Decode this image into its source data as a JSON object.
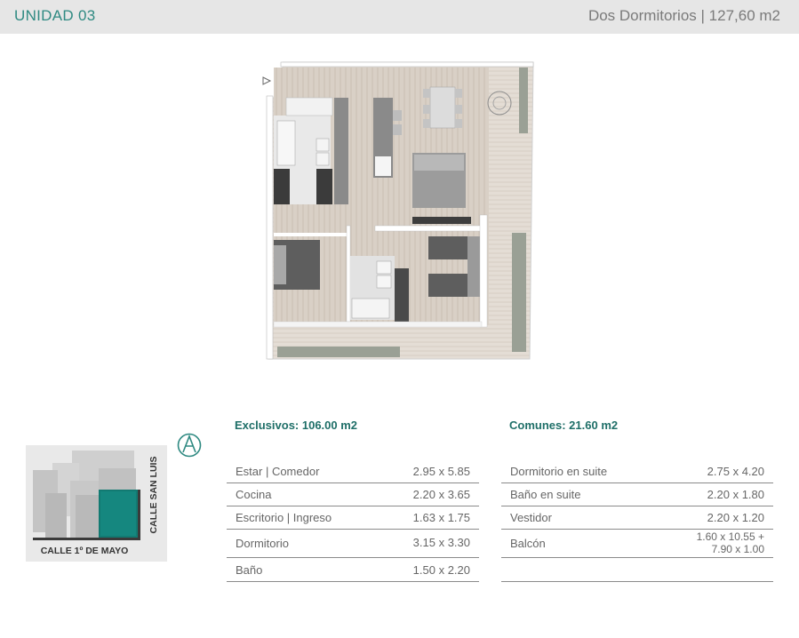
{
  "header": {
    "unit_title": "UNIDAD 03",
    "subtitle": "Dos Dormitorios | 127,60 m2"
  },
  "exclusivos": {
    "title": "Exclusivos: 106.00 m2",
    "rows": [
      {
        "label": "Estar | Comedor",
        "value": "2.95 x 5.85"
      },
      {
        "label": "Cocina",
        "value": "2.20 x 3.65"
      },
      {
        "label": "Escritorio | Ingreso",
        "value": "1.63 x 1.75"
      },
      {
        "label": "Dormitorio",
        "value": "3.15 x 3.30"
      },
      {
        "label": "Baño",
        "value": "1.50 x 2.20"
      }
    ]
  },
  "comunes": {
    "title": "Comunes: 21.60 m2",
    "rows": [
      {
        "label": "Dormitorio en suite",
        "value": "2.75 x 4.20"
      },
      {
        "label": "Baño en suite",
        "value": "2.20 x 1.80"
      },
      {
        "label": "Vestidor",
        "value": "2.20 x 1.20"
      },
      {
        "label": "Balcón",
        "value_line1": "1.60 x 10.55 +",
        "value_line2": "7.90 x 1.00"
      },
      {
        "label": "",
        "value": ""
      }
    ]
  },
  "keyplan": {
    "street_bottom": "CALLE 1º DE MAYO",
    "street_right": "CALLE SAN LUIS"
  },
  "compass": {
    "letter": "A"
  },
  "colors": {
    "accent": "#2f8a82",
    "highlight": "#127a72"
  }
}
